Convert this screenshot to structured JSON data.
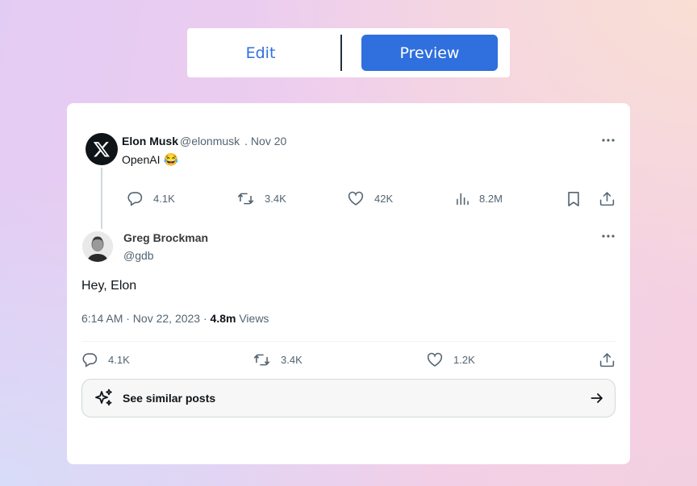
{
  "toggle": {
    "edit_label": "Edit",
    "preview_label": "Preview",
    "active": "Preview"
  },
  "quoted_tweet": {
    "author_name": "Elon Musk",
    "author_handle": "@elonmusk",
    "date": ". Nov 20",
    "text": "OpenAI",
    "emoji": "😂",
    "avatar_icon": "x-logo-icon",
    "stats": {
      "replies": "4.1K",
      "retweets": "3.4K",
      "likes": "42K",
      "views": "8.2M"
    }
  },
  "reply_tweet": {
    "author_name": "Greg Brockman",
    "author_handle": "@gdb",
    "text": "Hey, Elon",
    "timestamp": "6:14 AM · Nov 22, 2023 · ",
    "views_count": "4.8m",
    "views_label": " Views",
    "stats": {
      "replies": "4.1K",
      "retweets": "3.4K",
      "likes": "1.2K"
    }
  },
  "similar_posts_label": "See similar posts",
  "colors": {
    "accent": "#2f6fde",
    "muted_text": "#536471",
    "text": "#0f1419"
  }
}
